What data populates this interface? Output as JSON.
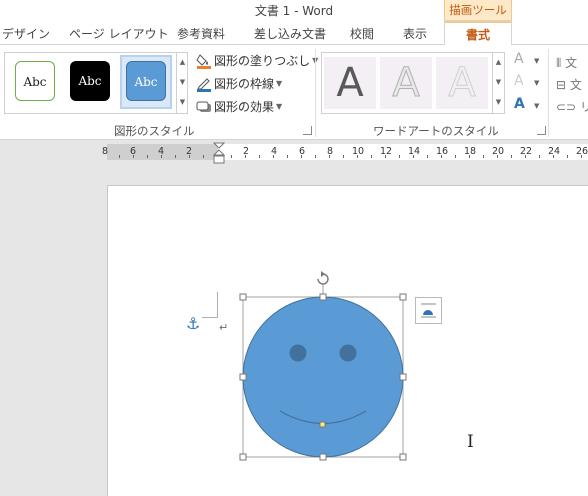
{
  "window": {
    "title": "文書 1 - Word",
    "context_tab_group": "描画ツール"
  },
  "tabs": [
    {
      "label": "デザイン"
    },
    {
      "label": "ページ レイアウト"
    },
    {
      "label": "参考資料"
    },
    {
      "label": "差し込み文書"
    },
    {
      "label": "校閲"
    },
    {
      "label": "表示"
    },
    {
      "label": "書式",
      "active": true
    }
  ],
  "ribbon": {
    "shape_styles": {
      "group_label": "図形のスタイル",
      "swatch_text": "Abc",
      "swatches": [
        {
          "name": "outline-green",
          "fill": "#ffffff",
          "border": "#70ad47"
        },
        {
          "name": "black-fill",
          "fill": "#000000",
          "border": "#000000"
        },
        {
          "name": "blue-fill",
          "fill": "#5b9bd5",
          "border": "#41719c",
          "selected": true
        }
      ],
      "commands": {
        "fill": "図形の塗りつぶし",
        "outline": "図形の枠線",
        "effects": "図形の効果"
      }
    },
    "wordart_styles": {
      "group_label": "ワードアートのスタイル",
      "sample_letter": "A",
      "small_letter": "A",
      "cut_text_1": "文",
      "cut_text_2": "文",
      "cut_text_3": "リ"
    }
  },
  "ruler": {
    "numbers": [
      "8",
      "6",
      "4",
      "2",
      "2",
      "4",
      "6",
      "8",
      "10",
      "12",
      "14",
      "16",
      "18",
      "20",
      "22",
      "24",
      "26"
    ]
  },
  "document": {
    "shape": {
      "type": "smiley-face",
      "fill": "#5b9bd5",
      "outline": "#41719c",
      "selected": true
    },
    "paragraph_mark": "↵",
    "anchor_icon": "⚓",
    "ibeam": "I"
  },
  "colors": {
    "accent_context": "#c55a11",
    "context_header_bg": "#fde9c8",
    "selection_frame": "#b7d2ee"
  }
}
